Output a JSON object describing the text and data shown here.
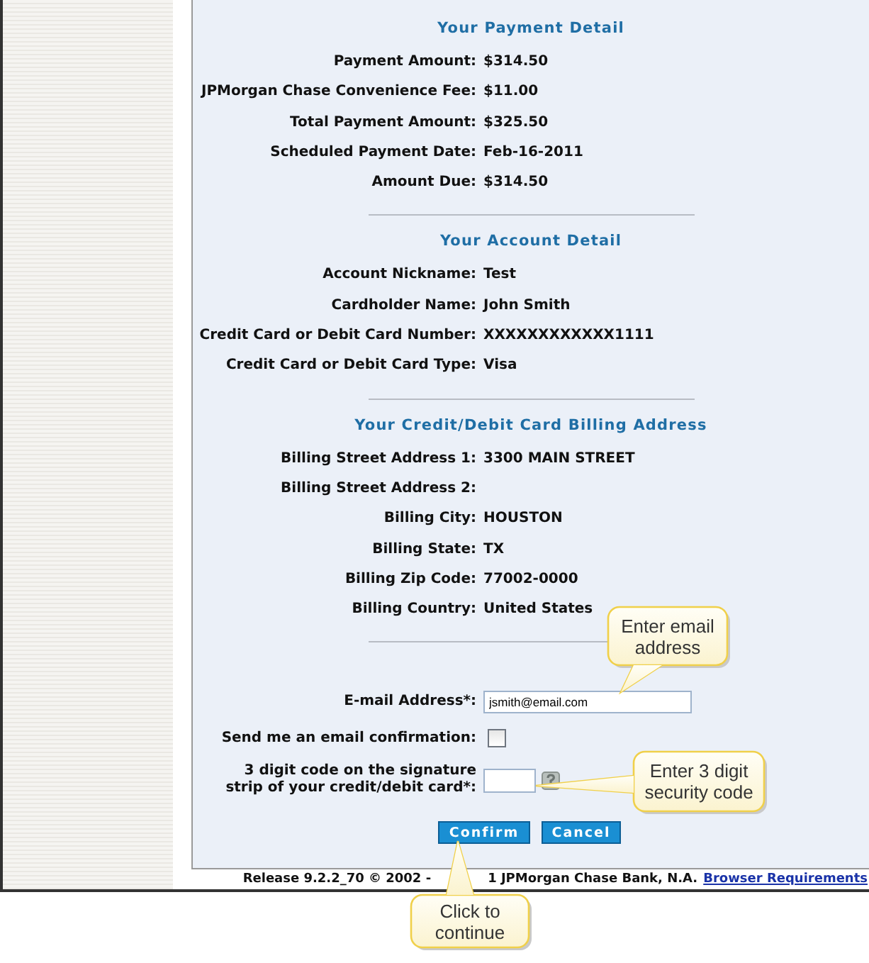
{
  "sections": [
    {
      "title": "Your Payment Detail",
      "rows": [
        {
          "label": "Payment Amount:",
          "value": "$314.50"
        },
        {
          "label": "JPMorgan Chase Convenience Fee:",
          "value": "$11.00"
        },
        {
          "label": "Total Payment Amount:",
          "value": "$325.50"
        },
        {
          "label": "Scheduled Payment Date:",
          "value": "Feb-16-2011"
        },
        {
          "label": "Amount Due:",
          "value": "$314.50"
        }
      ]
    },
    {
      "title": "Your Account Detail",
      "rows": [
        {
          "label": "Account Nickname:",
          "value": "Test"
        },
        {
          "label": "Cardholder Name:",
          "value": "John Smith"
        },
        {
          "label": "Credit Card or Debit Card Number:",
          "value": "XXXXXXXXXXXX1111"
        },
        {
          "label": "Credit Card or Debit Card Type:",
          "value": "Visa"
        }
      ]
    },
    {
      "title": "Your Credit/Debit Card Billing Address",
      "rows": [
        {
          "label": "Billing Street Address 1:",
          "value": "3300 MAIN STREET"
        },
        {
          "label": "Billing Street Address 2:"
        },
        {
          "label": "Billing City:",
          "value": "HOUSTON"
        },
        {
          "label": "Billing State:",
          "value": "TX"
        },
        {
          "label": "Billing Zip Code:",
          "value": "77002-0000"
        },
        {
          "label": "Billing Country:",
          "value": "United States"
        }
      ]
    }
  ],
  "form": {
    "email": {
      "label": "E-mail Address*:",
      "value": "jsmith@email.com"
    },
    "confirmation": {
      "label": "Send me an email confirmation:",
      "checked": false
    },
    "security_code": {
      "label": "3 digit code on the signature strip of your credit/debit card*:"
    }
  },
  "buttons": [
    "Confirm",
    "Cancel"
  ],
  "footer": {
    "text_1": "Release 9.2.2_70 © 2002 -",
    "text_2": "1 JPMorgan Chase Bank, N.A.",
    "link": "Browser Requirements"
  },
  "callouts": [
    "Enter email address",
    "Enter 3 digit security code",
    "Click to continue"
  ]
}
